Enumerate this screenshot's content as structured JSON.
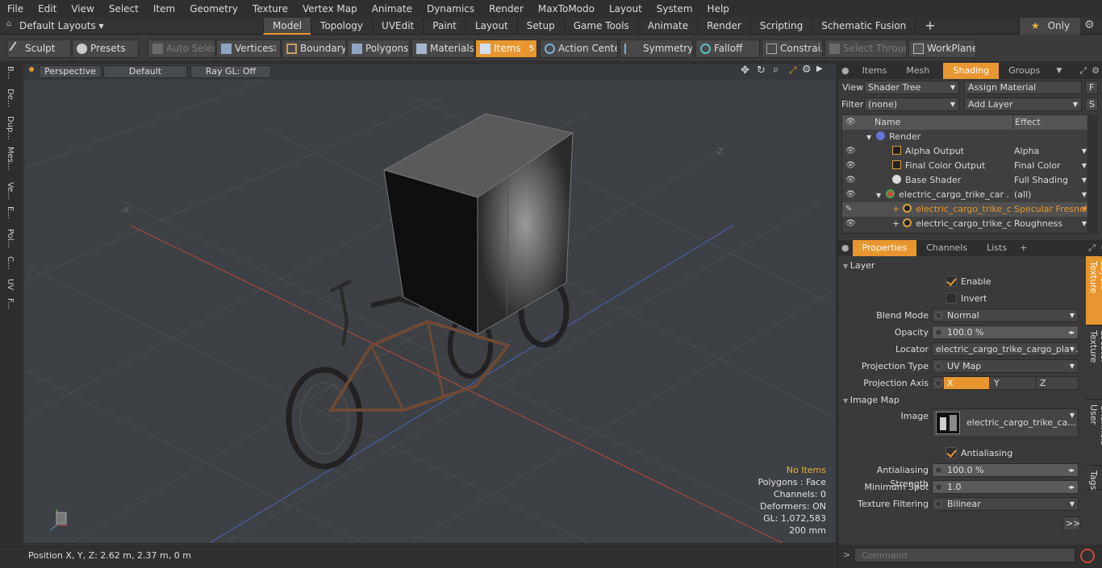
{
  "menu": [
    "File",
    "Edit",
    "View",
    "Select",
    "Item",
    "Geometry",
    "Texture",
    "Vertex Map",
    "Animate",
    "Dynamics",
    "Render",
    "MaxToModo",
    "Layout",
    "System",
    "Help"
  ],
  "layout_selector": "Default Layouts ▾",
  "mode_tabs": [
    "Model",
    "Topology",
    "UVEdit",
    "Paint",
    "Layout",
    "Setup",
    "Game Tools",
    "Animate",
    "Render",
    "Scripting",
    "Schematic Fusion"
  ],
  "active_tab": "Model",
  "only_label": "Only",
  "toolbar": {
    "sculpt": "Sculpt",
    "presets": "Presets",
    "auto_select": "Auto Select",
    "vertices": "Vertices",
    "vertices_count": "1",
    "boundary": "Boundary",
    "polygons": "Polygons",
    "materials": "Materials",
    "items": "Items",
    "items_count": "5",
    "action_center": "Action Center",
    "symmetry": "Symmetry",
    "falloff": "Falloff",
    "constraints": "Constrai...",
    "select_through": "Select Through",
    "workplane": "WorkPlane"
  },
  "left_strip": [
    "B...",
    "De...",
    "Dup...",
    "Mes...",
    "Ve...",
    "E...",
    "Pol...",
    "C...",
    "UV",
    "F..."
  ],
  "viewport": {
    "perspective": "Perspective",
    "default": "Default",
    "raygl": "Ray GL: Off",
    "info": [
      "No Items",
      "Polygons : Face",
      "Channels: 0",
      "Deformers: ON",
      "GL: 1,072,583",
      "200 mm"
    ],
    "info_highlight_color": "#e8b33a"
  },
  "status": "Position X, Y, Z:   2.62 m, 2.37 m, 0 m",
  "panel_tabs_top": [
    "Items",
    "Mesh ...",
    "Shading",
    "Groups"
  ],
  "panel_tabs_top_active": "Shading",
  "shader": {
    "view_label": "View",
    "view_value": "Shader Tree",
    "assign": "Assign Material",
    "f_btn": "F",
    "filter_label": "Filter",
    "filter_value": "(none)",
    "add_layer": "Add Layer",
    "s_btn": "S",
    "col_name": "Name",
    "col_effect": "Effect",
    "rows": [
      {
        "name": "Render",
        "effect": ""
      },
      {
        "name": "Alpha Output",
        "effect": "Alpha"
      },
      {
        "name": "Final Color Output",
        "effect": "Final Color"
      },
      {
        "name": "Base Shader",
        "effect": "Full Shading"
      },
      {
        "name": "electric_cargo_trike_car ...",
        "effect": "(all)"
      },
      {
        "name": "electric_cargo_trike_c...",
        "effect": "Specular Fresnel"
      },
      {
        "name": "electric_cargo_trike_c...",
        "effect": "Roughness"
      }
    ]
  },
  "panel_tabs_bottom": [
    "Properties",
    "Channels",
    "Lists"
  ],
  "props": {
    "layer_section": "Layer",
    "enable": "Enable",
    "invert": "Invert",
    "blend_mode_label": "Blend Mode",
    "blend_mode": "Normal",
    "opacity_label": "Opacity",
    "opacity": "100.0 %",
    "locator_label": "Locator",
    "locator": "electric_cargo_trike_cargo_plat...",
    "projection_type_label": "Projection Type",
    "projection_type": "UV Map",
    "projection_axis_label": "Projection Axis",
    "axis_x": "X",
    "axis_y": "Y",
    "axis_z": "Z",
    "image_map_section": "Image Map",
    "image_label": "Image",
    "image": "electric_cargo_trike_ca...",
    "antialiasing": "Antialiasing",
    "aa_strength_label": "Antialiasing Strength",
    "aa_strength": "100.0 %",
    "min_spot_label": "Minimum Spot",
    "min_spot": "1.0",
    "tex_filter_label": "Texture Filtering",
    "tex_filter": "Bilinear",
    "more_btn": ">>"
  },
  "side_tabs": [
    "Texture Layers",
    "Texture Locator",
    "User Channels",
    "Tags"
  ],
  "command_placeholder": "Command"
}
